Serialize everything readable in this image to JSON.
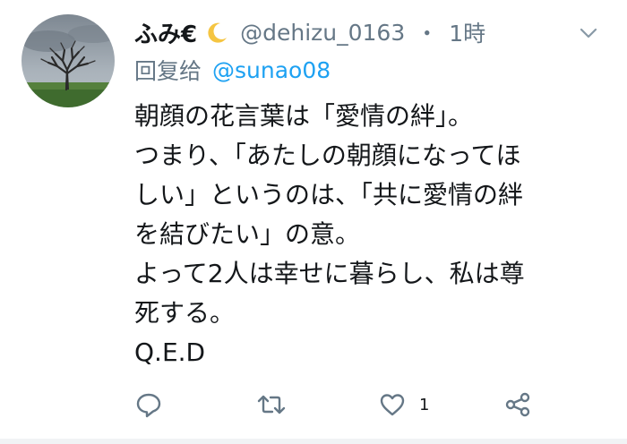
{
  "tweet": {
    "display_name": "ふみ€",
    "emoji_icon": "crescent-moon-icon",
    "handle": "@dehizu_0163",
    "separator": "・",
    "time": "1時",
    "reply": {
      "label": "回复给",
      "target": "@sunao08"
    },
    "body_lines": [
      "朝顔の花言葉は「愛情の絆」。",
      "つまり、「あたしの朝顔になってほ",
      "しい」というのは、「共に愛情の絆",
      "を結びたい」の意。",
      "よって2人は幸せに暮らし、私は尊",
      "死する。",
      "Q.E.D"
    ],
    "actions": {
      "reply_icon": "reply-icon",
      "retweet_icon": "retweet-icon",
      "like_icon": "heart-icon",
      "like_count": "1",
      "share_icon": "share-icon"
    },
    "colors": {
      "text": "#14171a",
      "secondary": "#657786",
      "link": "#1da1f2"
    }
  }
}
